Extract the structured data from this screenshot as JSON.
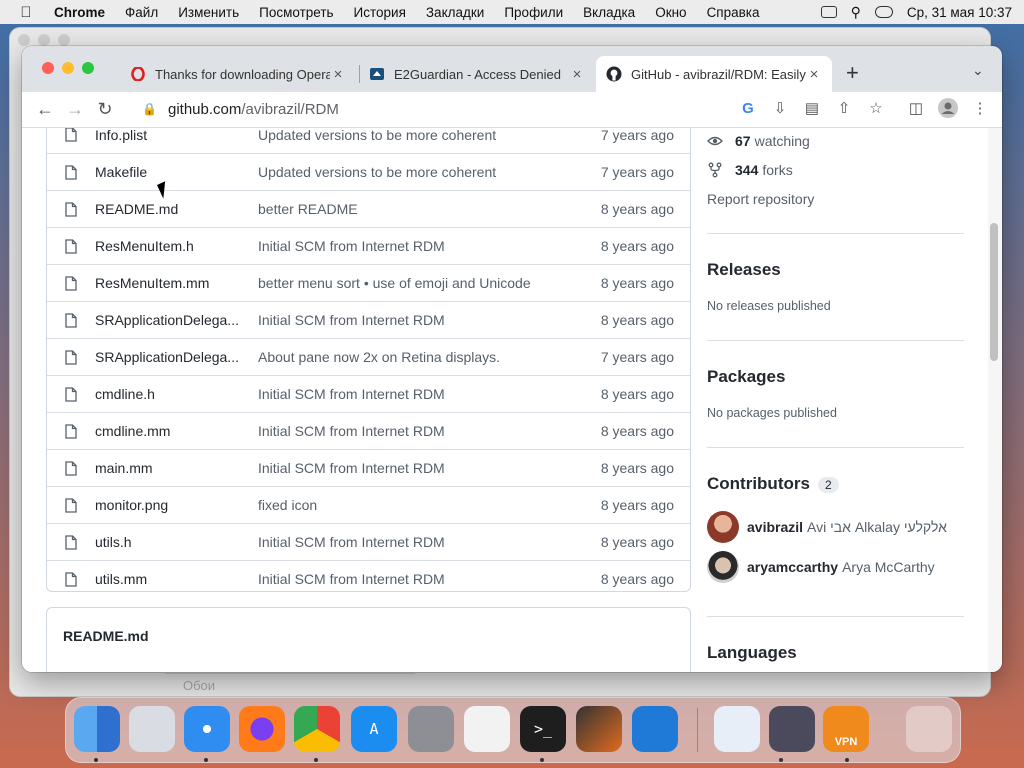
{
  "menubar": {
    "app": "Chrome",
    "items": [
      "Файл",
      "Изменить",
      "Посмотреть",
      "История",
      "Закладки",
      "Профили",
      "Вкладка",
      "Окно",
      "Справка"
    ],
    "datetime": "Ср, 31 мая  10:37"
  },
  "tabs": [
    {
      "title": "Thanks for downloading Opera",
      "favicon": "opera-icon",
      "active": false
    },
    {
      "title": "E2Guardian - Access Denied",
      "favicon": "e2guardian-icon",
      "active": false
    },
    {
      "title": "GitHub - avibrazil/RDM: Easily",
      "favicon": "github-icon",
      "active": true
    }
  ],
  "omnibox": {
    "host": "github.com",
    "path": "/avibrazil/RDM"
  },
  "files": [
    {
      "name": "Info.plist",
      "message": "Updated versions to be more coherent",
      "age": "7 years ago"
    },
    {
      "name": "Makefile",
      "message": "Updated versions to be more coherent",
      "age": "7 years ago"
    },
    {
      "name": "README.md",
      "message": "better README",
      "age": "8 years ago"
    },
    {
      "name": "ResMenuItem.h",
      "message": "Initial SCM from Internet RDM",
      "age": "8 years ago"
    },
    {
      "name": "ResMenuItem.mm",
      "message": "better menu sort • use of emoji and Unicode",
      "age": "8 years ago"
    },
    {
      "name": "SRApplicationDelega...",
      "message": "Initial SCM from Internet RDM",
      "age": "8 years ago"
    },
    {
      "name": "SRApplicationDelega...",
      "message": "About pane now 2x on Retina displays.",
      "age": "7 years ago"
    },
    {
      "name": "cmdline.h",
      "message": "Initial SCM from Internet RDM",
      "age": "8 years ago"
    },
    {
      "name": "cmdline.mm",
      "message": "Initial SCM from Internet RDM",
      "age": "8 years ago"
    },
    {
      "name": "main.mm",
      "message": "Initial SCM from Internet RDM",
      "age": "8 years ago"
    },
    {
      "name": "monitor.png",
      "message": "fixed icon",
      "age": "8 years ago"
    },
    {
      "name": "utils.h",
      "message": "Initial SCM from Internet RDM",
      "age": "8 years ago"
    },
    {
      "name": "utils.mm",
      "message": "Initial SCM from Internet RDM",
      "age": "8 years ago"
    }
  ],
  "readme": {
    "title": "README.md"
  },
  "sidebar": {
    "watching": {
      "count": "67",
      "label": "watching"
    },
    "forks": {
      "count": "344",
      "label": "forks"
    },
    "report": "Report repository",
    "releases": {
      "title": "Releases",
      "note": "No releases published"
    },
    "packages": {
      "title": "Packages",
      "note": "No packages published"
    },
    "contributors": {
      "title": "Contributors",
      "count": "2",
      "people": [
        {
          "login": "avibrazil",
          "name": "Avi אבי Alkalay אלקלעי"
        },
        {
          "login": "aryamccarthy",
          "name": "Arya McCarthy"
        }
      ]
    },
    "languages": {
      "title": "Languages"
    }
  },
  "background_window": {
    "ghost_label": "Обои"
  },
  "dock": {
    "apps": [
      "finder-icon",
      "launchpad-icon",
      "safari-icon",
      "firefox-icon",
      "chrome-icon",
      "app-store-icon",
      "system-preferences-icon",
      "textedit-icon",
      "terminal-icon",
      "garageband-icon",
      "vscode-icon"
    ],
    "right_apps": [
      "remote-desktop-icon",
      "browser-globe-icon",
      "vpn-icon",
      "trash-icon"
    ],
    "vpn_label": "VPN"
  },
  "colors": {
    "github_text": "#24292f",
    "muted": "#57606a",
    "border": "#d0d7de",
    "accent": "#0969da"
  }
}
